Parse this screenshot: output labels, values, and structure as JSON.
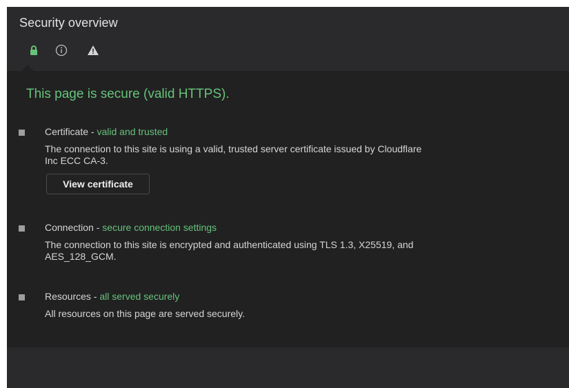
{
  "panel": {
    "title": "Security overview"
  },
  "tabs": [
    {
      "icon": "lock-icon",
      "color": "#67c37a"
    },
    {
      "icon": "info-icon",
      "color": "#bfbfbf"
    },
    {
      "icon": "warning-icon",
      "color": "#d6d6d6"
    }
  ],
  "summary": "This page is secure (valid HTTPS).",
  "sections": [
    {
      "label": "Certificate - ",
      "status": "valid and trusted",
      "description": "The connection to this site is using a valid, trusted server certificate issued by Cloudflare Inc ECC CA-3.",
      "button_label": "View certificate"
    },
    {
      "label": "Connection - ",
      "status": "secure connection settings",
      "description": "The connection to this site is encrypted and authenticated using TLS 1.3, X25519, and AES_128_GCM."
    },
    {
      "label": "Resources - ",
      "status": "all served securely",
      "description": "All resources on this page are served securely."
    }
  ],
  "colors": {
    "secure_green": "#67c37a",
    "panel_bg": "#2a2a2c",
    "content_bg": "#212122",
    "text": "#d6d6d6",
    "bullet": "#9e9e9e"
  }
}
